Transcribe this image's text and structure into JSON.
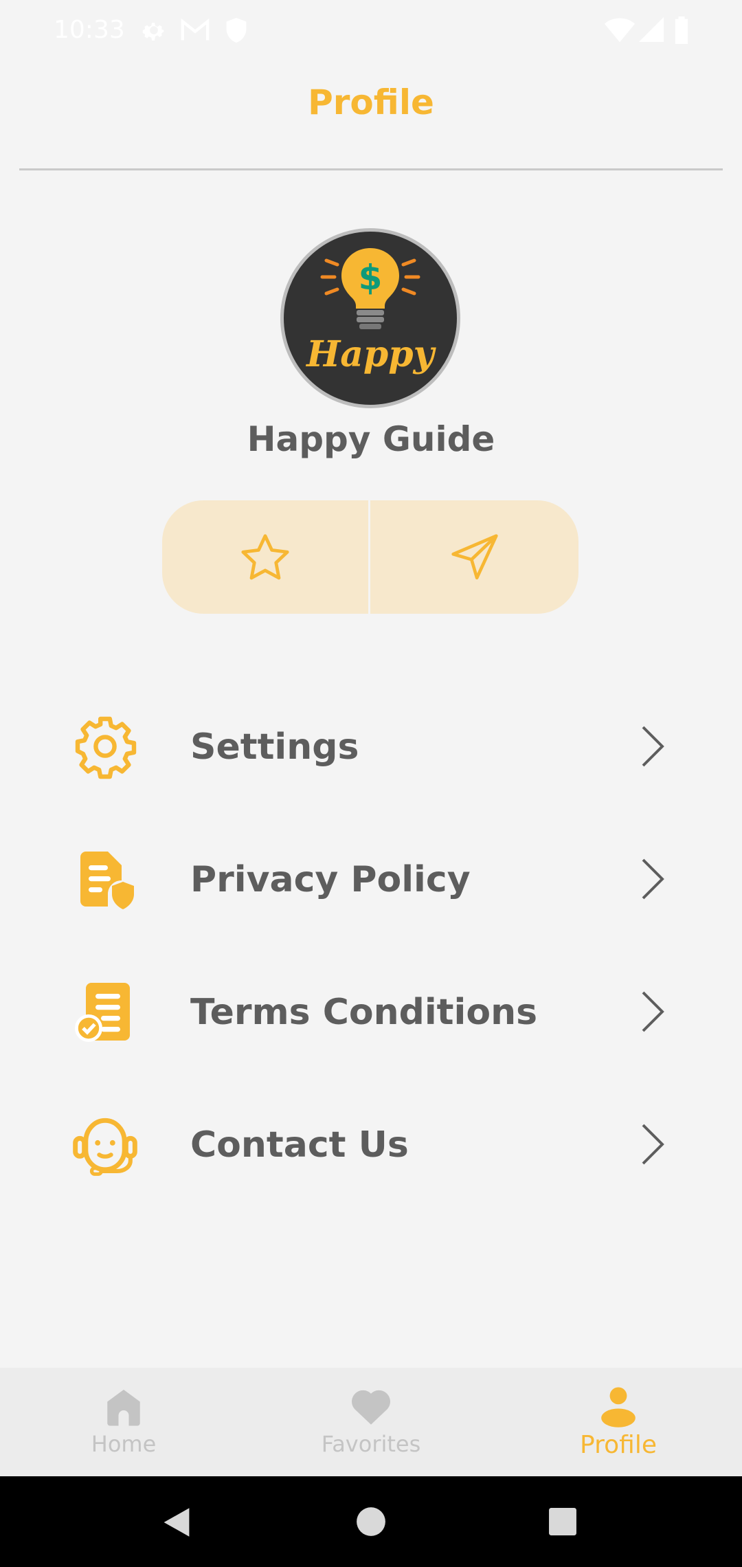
{
  "status_bar": {
    "time": "10:33",
    "icons": [
      "settings-icon",
      "gmail-icon",
      "shield-icon",
      "wifi-icon",
      "signal-icon",
      "battery-icon"
    ]
  },
  "header": {
    "title": "Profile"
  },
  "profile": {
    "avatar_text": "Happy",
    "avatar_symbol": "$",
    "name": "Happy Guide"
  },
  "actions": [
    {
      "icon": "star-icon"
    },
    {
      "icon": "send-icon"
    }
  ],
  "menu": [
    {
      "label": "Settings",
      "icon": "gear-icon"
    },
    {
      "label": "Privacy Policy",
      "icon": "privacy-document-icon"
    },
    {
      "label": "Terms Conditions",
      "icon": "terms-document-icon"
    },
    {
      "label": "Contact Us",
      "icon": "support-agent-icon"
    }
  ],
  "bottom_nav": [
    {
      "label": "Home",
      "icon": "home-icon",
      "active": false
    },
    {
      "label": "Favorites",
      "icon": "heart-icon",
      "active": false
    },
    {
      "label": "Profile",
      "icon": "person-icon",
      "active": true
    }
  ],
  "colors": {
    "accent": "#f7b733",
    "text_dark": "#5d5d5d",
    "inactive": "#c4c4c4",
    "background": "#f4f4f4",
    "pill_background": "#f7e8cc"
  }
}
